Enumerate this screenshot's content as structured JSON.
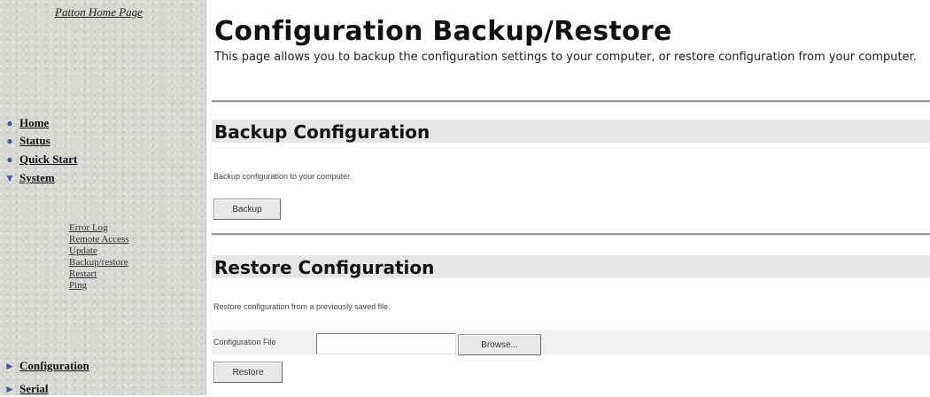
{
  "sidebar": {
    "home_link": "Patton Home Page",
    "items": [
      {
        "icon": "bullet-icon",
        "label": "Home"
      },
      {
        "icon": "bullet-icon",
        "label": "Status"
      },
      {
        "icon": "bullet-icon",
        "label": "Quick Start"
      },
      {
        "icon": "triangle-down-icon",
        "label": "System"
      }
    ],
    "system_sub": [
      "Error Log",
      "Remote Access",
      "Update",
      "Backup/restore",
      "Restart",
      "Ping"
    ],
    "bottom_items": [
      {
        "icon": "triangle-right-icon",
        "label": "Configuration"
      },
      {
        "icon": "triangle-right-icon",
        "label": "Serial"
      }
    ]
  },
  "main": {
    "title": "Configuration Backup/Restore",
    "description": "This page allows you to backup the configuration settings to your computer, or restore configuration from your computer.",
    "backup": {
      "heading": "Backup Configuration",
      "text": "Backup configuration to your computer.",
      "button": "Backup"
    },
    "restore": {
      "heading": "Restore Configuration",
      "text": "Restore configuration from a previously saved file.",
      "field_label": "Configuration File",
      "file_value": "",
      "browse_button": "Browse...",
      "button": "Restore"
    }
  }
}
